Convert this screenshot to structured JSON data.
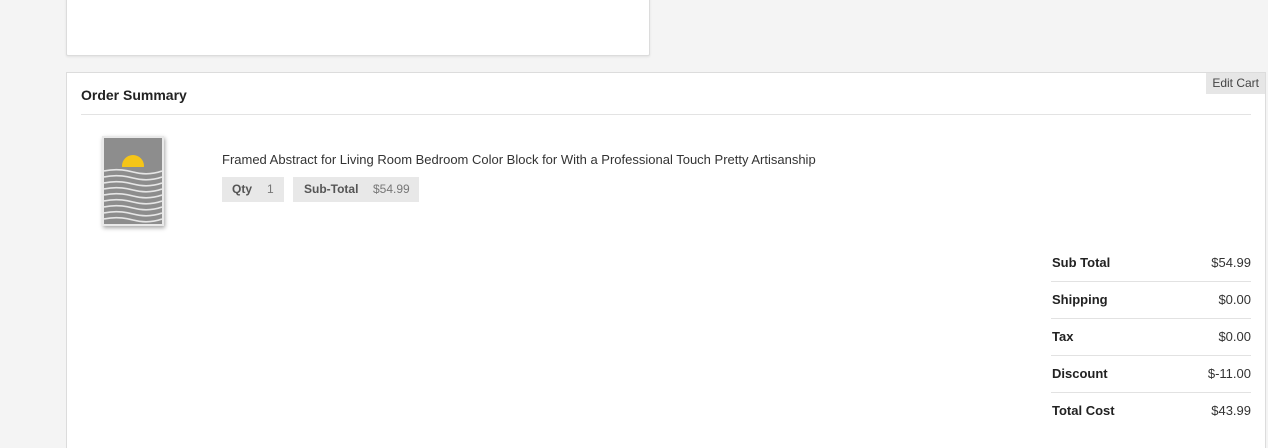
{
  "order_summary": {
    "title": "Order Summary",
    "edit_cart_label": "Edit Cart",
    "item": {
      "name": "Framed Abstract for Living Room Bedroom Color Block for With a Professional Touch Pretty Artisanship",
      "qty_label": "Qty",
      "qty_value": "1",
      "subtotal_label": "Sub-Total",
      "subtotal_value": "$54.99",
      "thumbnail_icon": "framed-abstract-art-thumbnail",
      "thumbnail_colors": {
        "background": "#8d8d8d",
        "sun": "#f5c518",
        "waves": "#e6e6e6"
      }
    },
    "totals": [
      {
        "label": "Sub Total",
        "value": "$54.99"
      },
      {
        "label": "Shipping",
        "value": "$0.00"
      },
      {
        "label": "Tax",
        "value": "$0.00"
      },
      {
        "label": "Discount",
        "value": "$-11.00"
      },
      {
        "label": "Total Cost",
        "value": "$43.99"
      }
    ]
  }
}
